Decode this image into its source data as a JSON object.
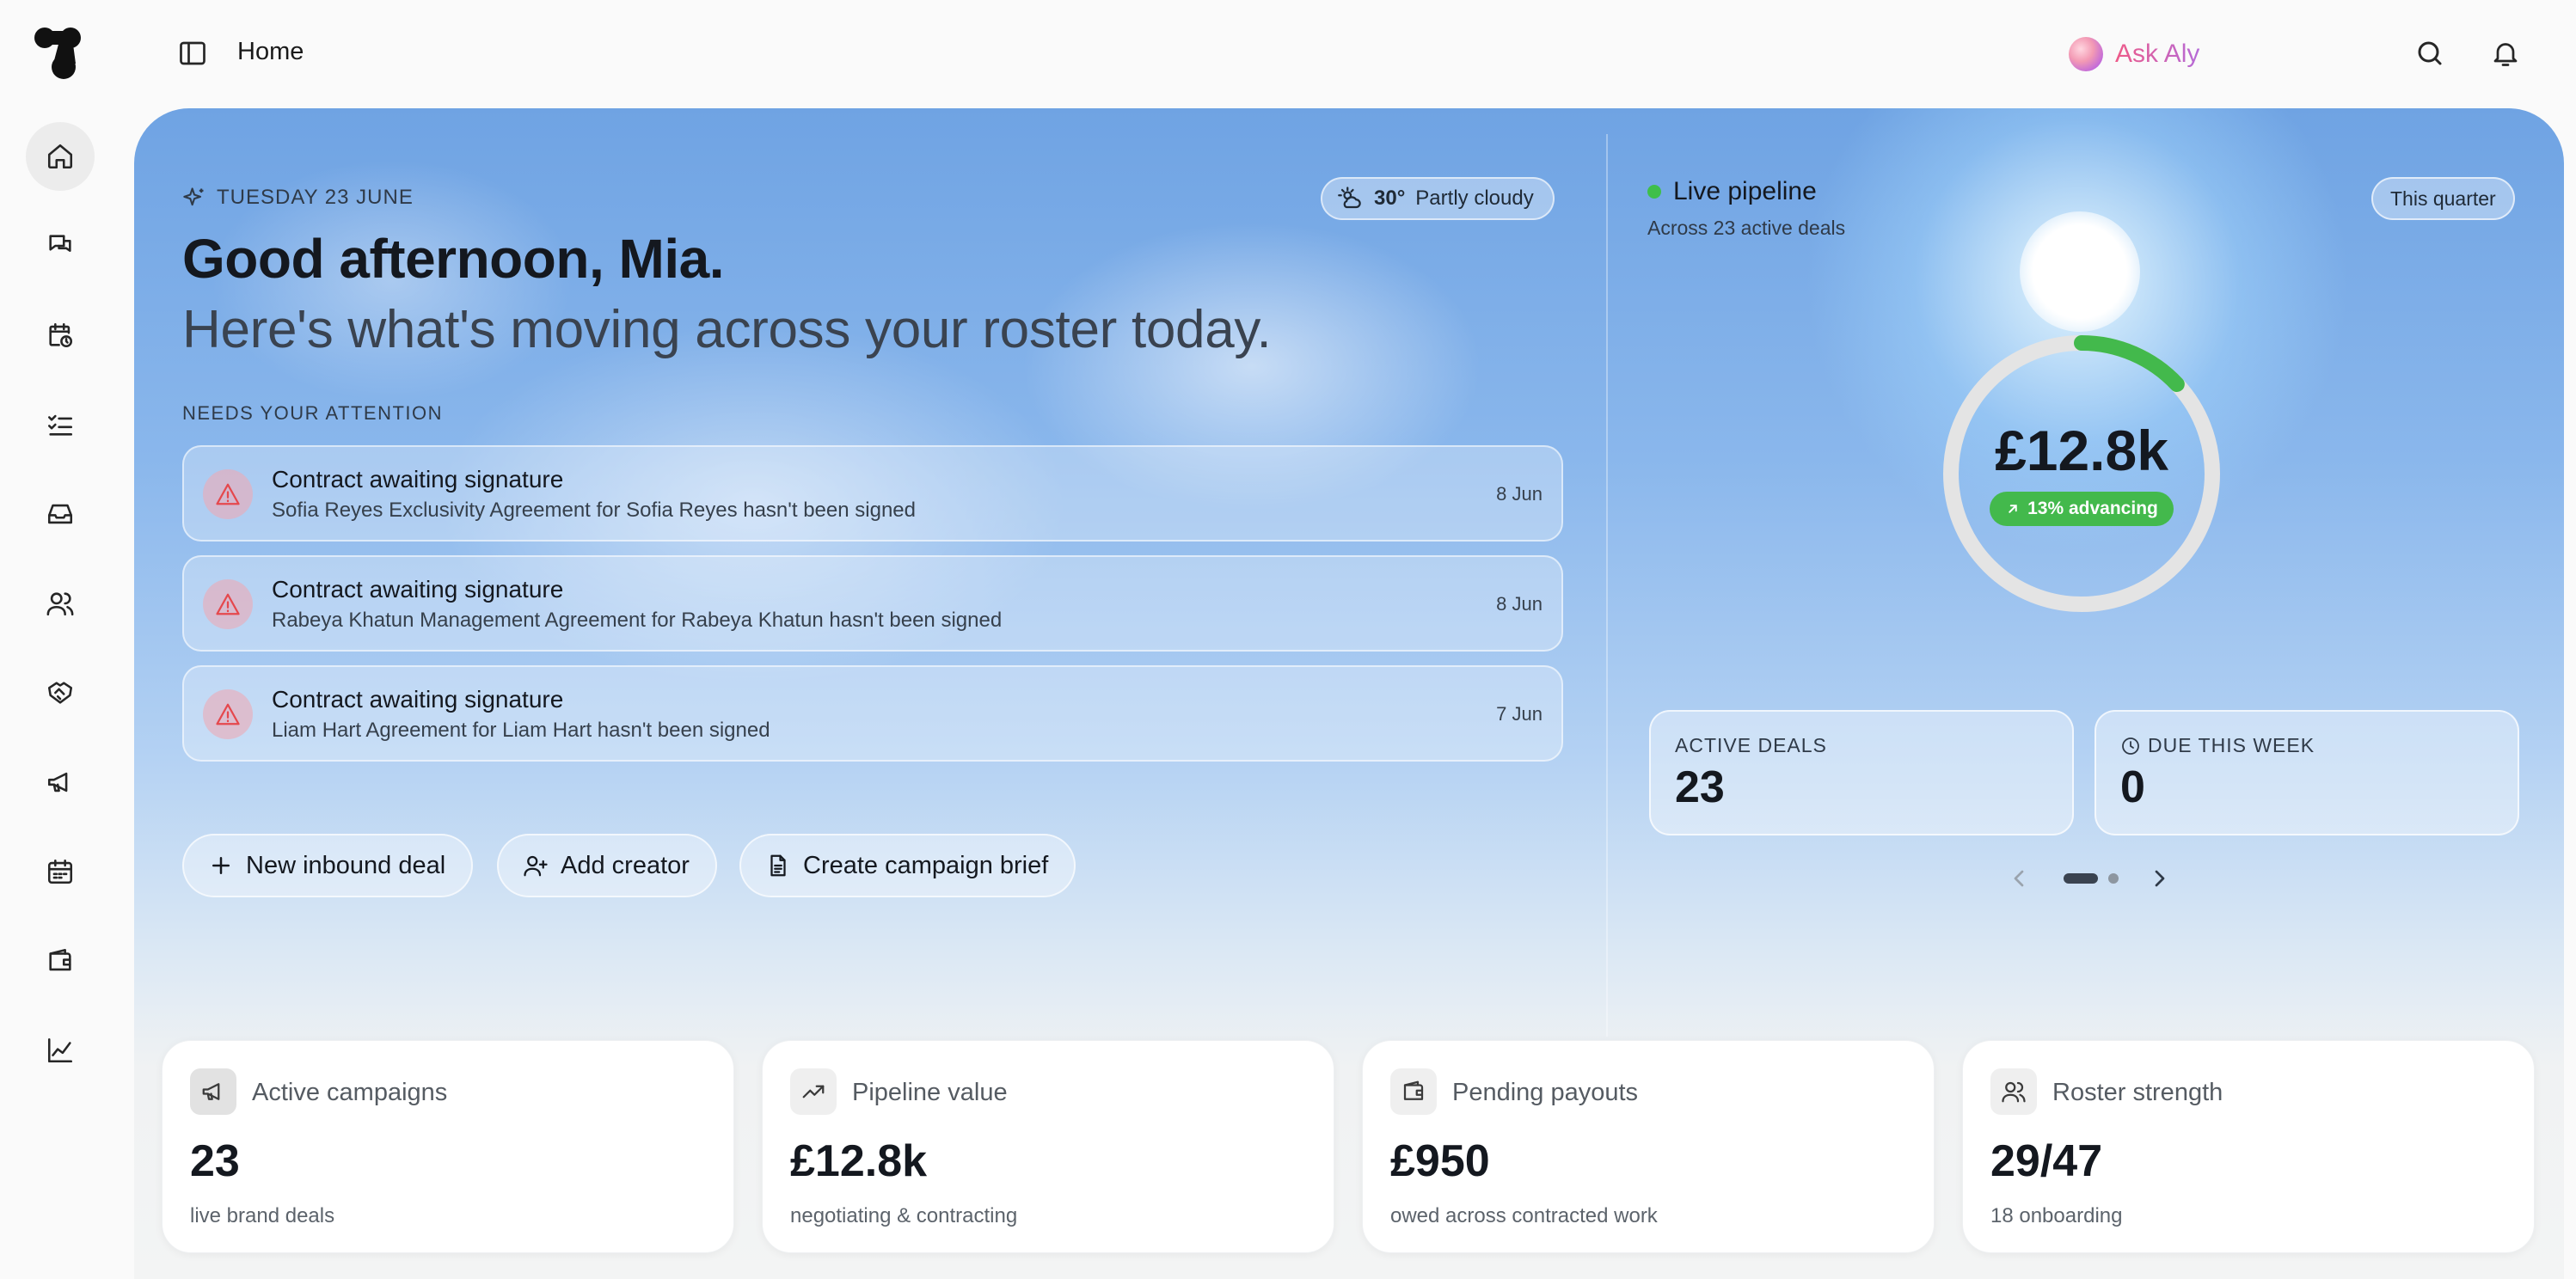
{
  "header": {
    "page_title": "Home",
    "ask_label": "Ask Aly"
  },
  "hero": {
    "date": "TUESDAY 23 JUNE",
    "weather": {
      "temp": "30°",
      "condition": "Partly cloudy"
    },
    "greeting": "Good afternoon, Mia.",
    "subgreeting": "Here's what's moving across your roster today.",
    "attention_label": "NEEDS YOUR ATTENTION",
    "alerts": [
      {
        "title": "Contract awaiting signature",
        "desc": "Sofia Reyes Exclusivity Agreement for Sofia Reyes hasn't been signed",
        "date": "8 Jun"
      },
      {
        "title": "Contract awaiting signature",
        "desc": "Rabeya Khatun Management Agreement for Rabeya Khatun hasn't been signed",
        "date": "8 Jun"
      },
      {
        "title": "Contract awaiting signature",
        "desc": "Liam Hart Agreement for Liam Hart hasn't been signed",
        "date": "7 Jun"
      }
    ],
    "actions": {
      "new_deal": "New inbound deal",
      "add_creator": "Add creator",
      "create_brief": "Create campaign brief"
    }
  },
  "pipeline": {
    "title": "Live pipeline",
    "subtitle": "Across 23 active deals",
    "period": "This quarter",
    "value": "£12.8k",
    "badge": "13% advancing",
    "progress": 0.13,
    "stats": {
      "active_label": "ACTIVE DEALS",
      "active_value": "23",
      "due_label": "DUE THIS WEEK",
      "due_value": "0"
    },
    "carousel": {
      "current": 1,
      "total": 2
    }
  },
  "metrics": [
    {
      "title": "Active campaigns",
      "value": "23",
      "sub": "live brand deals"
    },
    {
      "title": "Pipeline value",
      "value": "£12.8k",
      "sub": "negotiating & contracting"
    },
    {
      "title": "Pending payouts",
      "value": "£950",
      "sub": "owed across contracted work"
    },
    {
      "title": "Roster strength",
      "value": "29/47",
      "sub": "18 onboarding"
    }
  ],
  "colors": {
    "accent_green": "#43b94c",
    "alert_red": "#e5484d",
    "ask_gradient_start": "#ee5a88",
    "ask_gradient_end": "#b56ad8"
  },
  "icons": {
    "sidebar": [
      "home-icon",
      "chat-icon",
      "calendar-clock-icon",
      "checklist-icon",
      "inbox-icon",
      "users-icon",
      "handshake-icon",
      "megaphone-icon",
      "calendar-icon",
      "wallet-icon",
      "chart-line-icon"
    ]
  }
}
